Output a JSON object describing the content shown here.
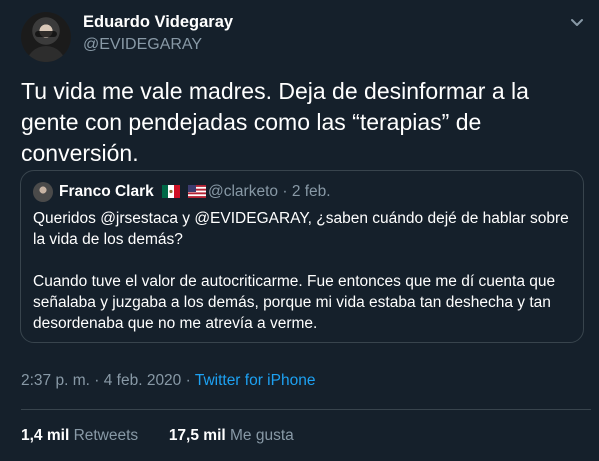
{
  "author": {
    "name": "Eduardo Videgaray",
    "handle": "@EVIDEGARAY",
    "avatar_icon": "profile-photo"
  },
  "tweet": {
    "text": "Tu vida me vale madres. Deja de desinformar a la gente con pendejadas como las “terapias” de conversión."
  },
  "quoted": {
    "name": "Franco Clark",
    "flags": [
      "mexico-flag",
      "usa-flag"
    ],
    "handle": "@clarketo",
    "separator": "·",
    "date": "2 feb.",
    "text": "Queridos @jrsestaca y @EVIDEGARAY, ¿saben cuándo dejé de hablar sobre la vida de los demás?\n\nCuando tuve el valor de autocriticarme. Fue entonces que me dí cuenta que señalaba y juzgaba a los demás, porque mi vida estaba tan deshecha y tan desordenaba que no me atrevía a verme."
  },
  "meta": {
    "time": "2:37 p. m.",
    "sep1": "·",
    "date": "4 feb. 2020",
    "sep2": "·",
    "source": "Twitter for iPhone"
  },
  "stats": {
    "retweets_count": "1,4 mil",
    "retweets_label": "Retweets",
    "likes_count": "17,5 mil",
    "likes_label": "Me gusta"
  },
  "colors": {
    "background": "#15202b",
    "secondary_text": "#8899a6",
    "accent": "#1da1f2",
    "border": "#38444d"
  }
}
